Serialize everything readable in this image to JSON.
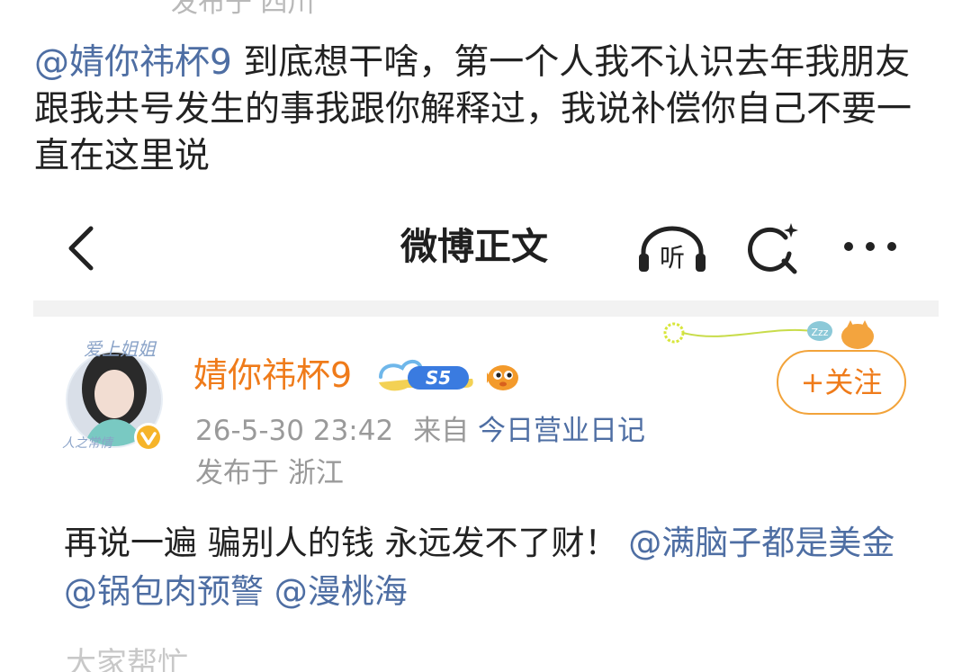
{
  "outer_post": {
    "top_cut_text": "发布于 四川",
    "mention": "@婧你祎杯9",
    "body": " 到底想干啥，第一个人我不认识去年我朋友跟我共号发生的事我跟你解释过，我说补偿你自己不要一直在这里说"
  },
  "screenshot": {
    "header": {
      "back_icon": "chevron-left-icon",
      "title": "微博正文",
      "listen_icon": "listen-headphones-icon",
      "listen_label": "听",
      "search_icon": "search-icon",
      "more_icon": "more-dots-icon"
    },
    "user": {
      "name": "婧你祎杯9",
      "avatar_text_top": "爱上姐姐",
      "avatar_text_bottom": "人之常情",
      "level_badge": "S5",
      "verified_icon": "verified-v-icon",
      "fish_icon": "pufferfish-badge-icon"
    },
    "follow_button": "+关注",
    "meta": {
      "date": "26-5-30 23:42",
      "from_label": "来自",
      "source": "今日营业日记",
      "location": "发布于 浙江"
    },
    "post": {
      "text": "再说一遍 骗别人的钱 永远发不了财！",
      "mentions": [
        "@满脑子都是美金",
        "@锅包肉预警",
        "@漫桃海"
      ]
    },
    "bottom_cut_text": "大家帮忙"
  },
  "colors": {
    "accent_orange": "#ef7b1a",
    "link_blue": "#4e6ea3",
    "meta_gray": "#9a9a9a"
  }
}
